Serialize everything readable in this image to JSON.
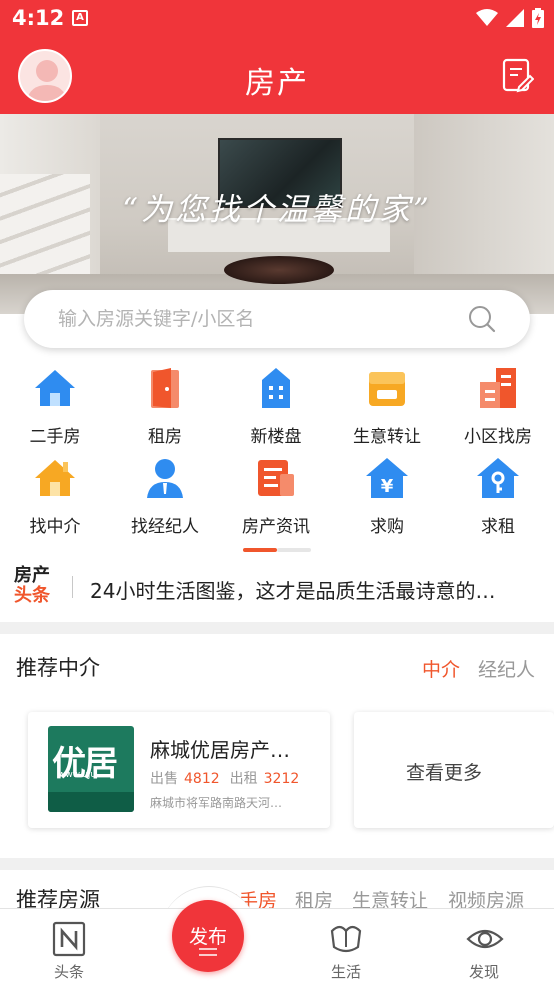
{
  "status_bar": {
    "time": "4:12",
    "notification_letter": "A"
  },
  "header": {
    "title": "房产"
  },
  "banner": {
    "slogan": "“为您找个温馨的家”"
  },
  "search": {
    "placeholder": "输入房源关键字/小区名"
  },
  "categories": [
    {
      "label": "二手房",
      "icon": "house-icon",
      "color": "#2f8cf0"
    },
    {
      "label": "租房",
      "icon": "door-icon",
      "color": "#f0562c"
    },
    {
      "label": "新楼盘",
      "icon": "building-icon",
      "color": "#2f8cf0"
    },
    {
      "label": "生意转让",
      "icon": "shop-icon",
      "color": "#f7a823"
    },
    {
      "label": "小区找房",
      "icon": "apartment-icon",
      "color": "#f0562c"
    },
    {
      "label": "找中介",
      "icon": "agency-house-icon",
      "color": "#f7a823"
    },
    {
      "label": "找经纪人",
      "icon": "agent-person-icon",
      "color": "#2f8cf0"
    },
    {
      "label": "房产资讯",
      "icon": "news-doc-icon",
      "color": "#f0562c"
    },
    {
      "label": "求购",
      "icon": "yuan-house-icon",
      "color": "#2f8cf0"
    },
    {
      "label": "求租",
      "icon": "key-house-icon",
      "color": "#2f8cf0"
    }
  ],
  "news": {
    "logo_line1": "房产",
    "logo_line2": "头条",
    "headline": "24小时生活图鉴，这才是品质生活最诗意的…"
  },
  "agents": {
    "title": "推荐中介",
    "tabs": [
      "中介",
      "经纪人"
    ],
    "active_tab": "中介",
    "card": {
      "logo_text": "优居",
      "logo_url": "www.uju...",
      "name": "麻城优居房产…",
      "sale_label": "出售",
      "sale_count": "4812",
      "rent_label": "出租",
      "rent_count": "3212",
      "address": "麻城市将军路南路天河…"
    },
    "more": "查看更多"
  },
  "listings": {
    "title": "推荐房源",
    "tabs": [
      "二手房",
      "租房",
      "生意转让",
      "视频房源"
    ]
  },
  "bottom_nav": {
    "items": [
      {
        "label": "头条",
        "icon": "news-n-icon"
      },
      {
        "label": "生活",
        "icon": "life-icon"
      },
      {
        "label": "发现",
        "icon": "eye-icon"
      }
    ],
    "publish": "发布"
  },
  "colors": {
    "brand_red": "#f0353a",
    "accent_orange": "#f0562c",
    "muted": "#999999"
  }
}
